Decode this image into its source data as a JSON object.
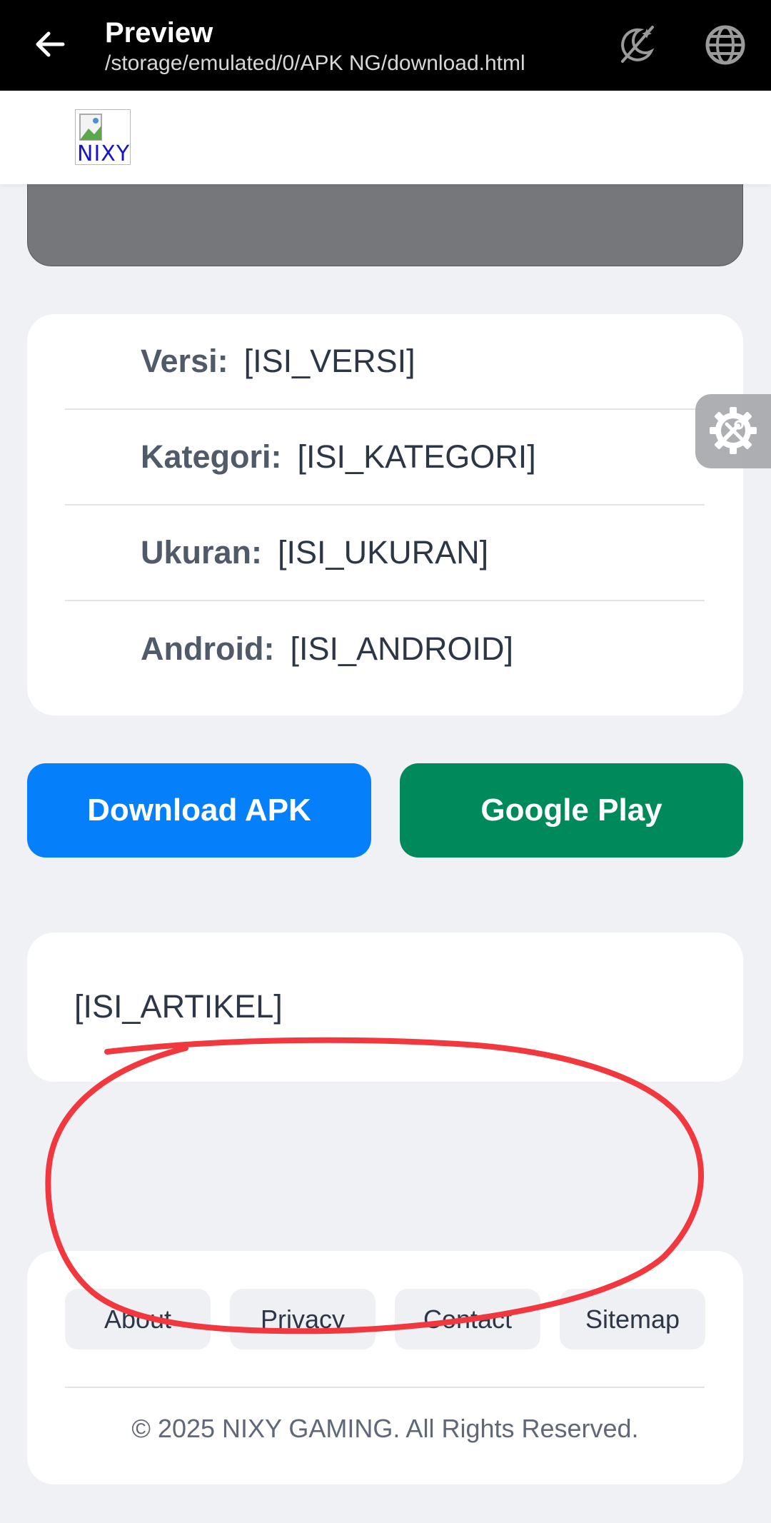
{
  "app_bar": {
    "title": "Preview",
    "path": "/storage/emulated/0/APK NG/download.html",
    "icons": [
      "back-arrow-icon",
      "theme-toggle-icon",
      "globe-icon"
    ]
  },
  "site": {
    "logo_alt": "NIXY"
  },
  "info": [
    {
      "label": "Versi:",
      "value": "[ISI_VERSI]"
    },
    {
      "label": "Kategori:",
      "value": "[ISI_KATEGORI]"
    },
    {
      "label": "Ukuran:",
      "value": "[ISI_UKURAN]"
    },
    {
      "label": "Android:",
      "value": "[ISI_ANDROID]"
    }
  ],
  "buttons": {
    "download": "Download APK",
    "play": "Google Play"
  },
  "article": {
    "text": "[ISI_ARTIKEL]"
  },
  "footer": {
    "links": [
      "About",
      "Privacy",
      "Contact",
      "Sitemap"
    ],
    "copyright": "© 2025 NIXY GAMING. All Rights Reserved."
  },
  "colors": {
    "download": "#067ffb",
    "play": "#008a5b",
    "scribble": "#f0383e"
  }
}
